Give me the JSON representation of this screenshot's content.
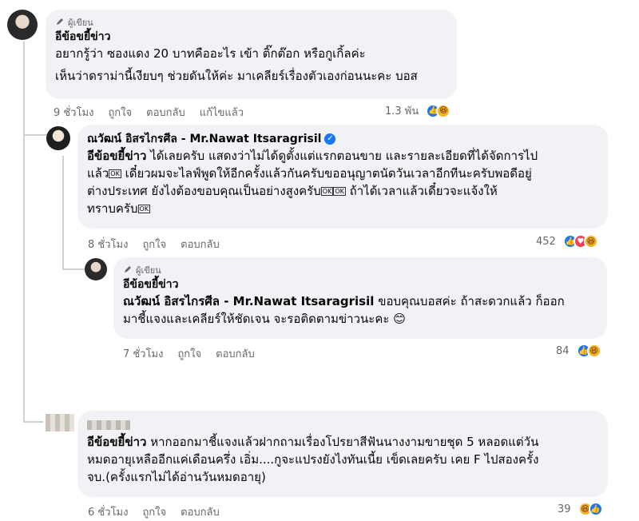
{
  "comments": [
    {
      "author_badge": "ผู้เขียน",
      "name": "อีข้อขยี้ข่าว",
      "lines": [
        "อยากรู้ว่า ซองแดง 20 บาทคืออะไร เข้า ติ๊กต๊อก หรือกูเกิ้ลค่ะ",
        "เห็นว่าดราม่านี้เงียบๆ ช่วยดันให้ค่ะ มาเคลียร์เรื่องตัวเองก่อนนะคะ บอส"
      ],
      "time": "9 ชั่วโมง",
      "like": "ถูกใจ",
      "reply": "ตอบกลับ",
      "edited": "แก้ไขแล้ว",
      "reaction_count": "1.3 พัน"
    },
    {
      "name": "ณวัฒน์ อิสรไกรศีล - Mr.Nawat Itsaragrisil",
      "tag": "อีข้อขยี้ข่าว",
      "lines": [
        "ได้เลยครับ แสดงว่าไม่ได้ดูตั้งแต่แรกตอนขาย และรายละเอียดที่ได้จัดการไป",
        "แล้ว",
        "เดี๋ยวผมจะไลฟ์พูดให้อีกครั้งแล้วกันครับขออนุญาตนัดวันเวลาอีกทีนะครับพอดีอยู่",
        "ต่างประเทศ ยังไงต้องขอบคุณเป็นอย่างสูงครับ",
        "ถ้าได้เวลาแล้วเดี๋ยวจะแจ้งให้",
        "ทราบครับ"
      ],
      "ok_symbol": "OK",
      "time": "8 ชั่วโมง",
      "like": "ถูกใจ",
      "reply": "ตอบกลับ",
      "reaction_count": "452"
    },
    {
      "author_badge": "ผู้เขียน",
      "name": "อีข้อขยี้ข่าว",
      "tag": "ณวัฒน์ อิสรไกรศีล - Mr.Nawat Itsaragrisil",
      "lines": [
        "ขอบคุณบอสค่ะ ถ้าสะดวกแล้ว ก็ออก",
        "มาชี้แจงและเคลียร์ให้ชัดเจน จะรอติดตามข่าวนะคะ"
      ],
      "emoji": "😊",
      "time": "7 ชั่วโมง",
      "like": "ถูกใจ",
      "reply": "ตอบกลับ",
      "reaction_count": "84"
    },
    {
      "tag": "อีข้อขยี้ข่าว",
      "lines": [
        "หากออกมาชี้แจงแล้วฝากถามเรื่องโปรยาสีฟันนางงามขายชุด 5 หลอดแต่วัน",
        "หมดอายุเหลืออีกแค่เดือนครึ่ง เอิ่ม....กูจะแปรงยังไงทันเนี้ย เข็ดเลยครับ เคย F ไปสองครั้ง",
        "จบ.(ครั้งแรกไม่ได้อ่านวันหมดอายุ)"
      ],
      "time": "6 ชั่วโมง",
      "like": "ถูกใจ",
      "reply": "ตอบกลับ",
      "reaction_count": "39"
    }
  ],
  "colors": {
    "bubble": "#f0f2f5",
    "meta": "#65676b",
    "like": "#1877f2",
    "haha": "#f7b125",
    "love": "#f33e58"
  },
  "icons": {
    "pencil": "pencil-icon",
    "verified": "verified-badge-icon",
    "like": "like-reaction-icon",
    "haha": "haha-reaction-icon",
    "love": "love-reaction-icon"
  }
}
